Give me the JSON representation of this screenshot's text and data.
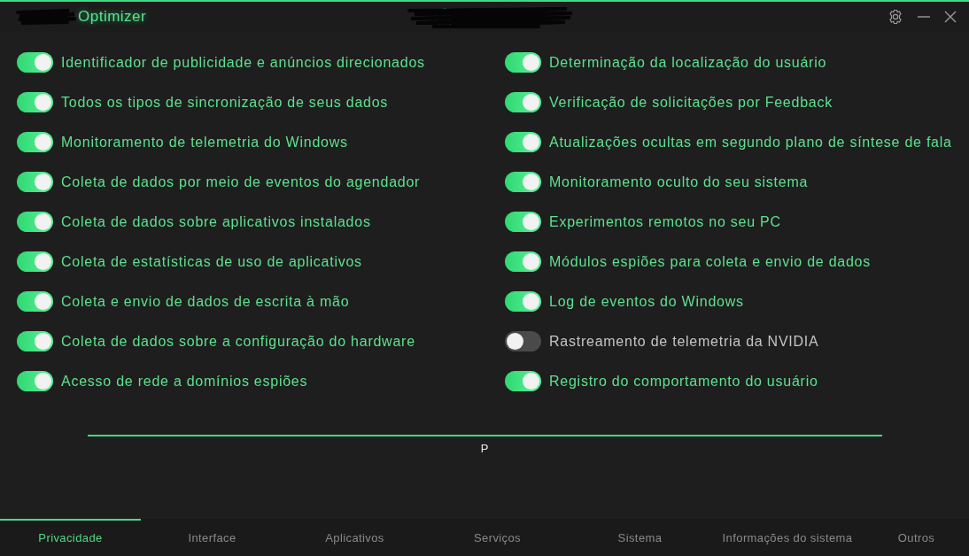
{
  "window": {
    "title": "Optimizer"
  },
  "columns": [
    {
      "toggles": [
        {
          "label": "Identificador de publicidade e anúncios direcionados",
          "on": true
        },
        {
          "label": "Todos os tipos de sincronização de seus dados",
          "on": true
        },
        {
          "label": "Monitoramento de telemetria do Windows",
          "on": true
        },
        {
          "label": "Coleta de dados por meio de eventos do agendador",
          "on": true
        },
        {
          "label": "Coleta de dados sobre aplicativos instalados",
          "on": true
        },
        {
          "label": "Coleta de estatísticas de uso de aplicativos",
          "on": true
        },
        {
          "label": "Coleta e envio de dados de escrita à mão",
          "on": true
        },
        {
          "label": "Coleta de dados sobre a configuração do hardware",
          "on": true
        },
        {
          "label": "Acesso de rede a domínios espiões",
          "on": true
        }
      ]
    },
    {
      "toggles": [
        {
          "label": "Determinação da localização do usuário",
          "on": true
        },
        {
          "label": "Verificação de solicitações por Feedback",
          "on": true
        },
        {
          "label": "Atualizações ocultas em segundo plano de síntese de fala",
          "on": true
        },
        {
          "label": "Monitoramento oculto do seu sistema",
          "on": true
        },
        {
          "label": "Experimentos remotos no seu PC",
          "on": true
        },
        {
          "label": "Módulos espiões para coleta e envio de dados",
          "on": true
        },
        {
          "label": "Log de eventos do Windows",
          "on": true
        },
        {
          "label": "Rastreamento de telemetria da NVIDIA",
          "on": false
        },
        {
          "label": "Registro do comportamento do usuário",
          "on": true
        }
      ]
    }
  ],
  "status_text": "P",
  "tabs": [
    {
      "label": "Privacidade",
      "selected": true
    },
    {
      "label": "Interface",
      "selected": false
    },
    {
      "label": "Aplicativos",
      "selected": false
    },
    {
      "label": "Serviços",
      "selected": false
    },
    {
      "label": "Sistema",
      "selected": false
    },
    {
      "label": "Informações do sistema",
      "selected": false
    },
    {
      "label": "Outros",
      "selected": false
    }
  ]
}
